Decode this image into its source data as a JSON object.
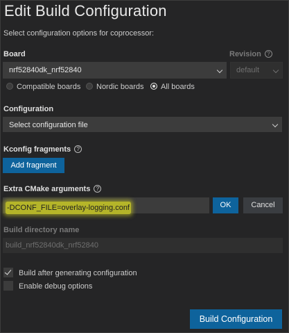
{
  "dialog": {
    "title": "Edit Build Configuration",
    "subtitle": "Select configuration options for coprocessor:"
  },
  "board": {
    "label": "Board",
    "value": "nrf52840dk_nrf52840",
    "revision_label": "Revision",
    "revision_value": "default",
    "filters": [
      {
        "label": "Compatible boards",
        "selected": false
      },
      {
        "label": "Nordic boards",
        "selected": false
      },
      {
        "label": "All boards",
        "selected": true
      }
    ]
  },
  "configuration": {
    "label": "Configuration",
    "value": "Select configuration file"
  },
  "kconfig": {
    "label": "Kconfig fragments",
    "add_button": "Add fragment"
  },
  "cmake": {
    "label": "Extra CMake arguments",
    "value": "-DCONF_FILE=overlay-logging.conf",
    "ok_button": "OK",
    "cancel_button": "Cancel"
  },
  "build_dir": {
    "label": "Build directory name",
    "placeholder": "build_nrf52840dk_nrf52840"
  },
  "options": {
    "build_after": {
      "label": "Build after generating configuration",
      "checked": true
    },
    "debug": {
      "label": "Enable debug options",
      "checked": false
    }
  },
  "footer": {
    "build_button": "Build Configuration"
  },
  "colors": {
    "accent": "#0e639c",
    "background": "#252526",
    "highlight": "#b5b529"
  }
}
